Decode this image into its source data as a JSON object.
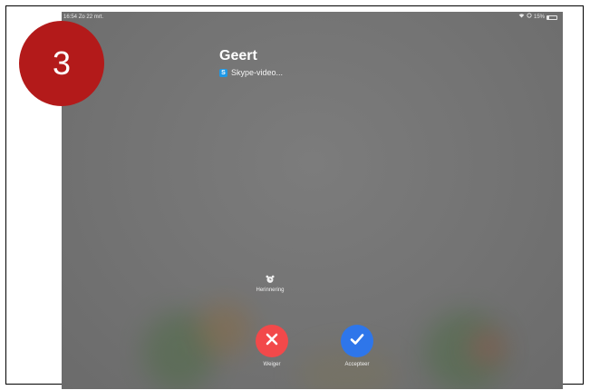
{
  "status_bar": {
    "time": "16:54",
    "date": "Zo 22 mrt.",
    "battery": "15%",
    "battery_level": 0.15
  },
  "call": {
    "caller_name": "Geert",
    "app_label": "Skype-video..."
  },
  "reminder": {
    "label": "Herinnering",
    "icon": "alarm-icon"
  },
  "actions": {
    "decline_label": "Weiger",
    "accept_label": "Accepteer"
  },
  "badge": {
    "number": "3"
  },
  "colors": {
    "badge": "#b31a1a",
    "decline": "#f2494a",
    "accept": "#2e76ea",
    "skype": "#1e98e6"
  }
}
